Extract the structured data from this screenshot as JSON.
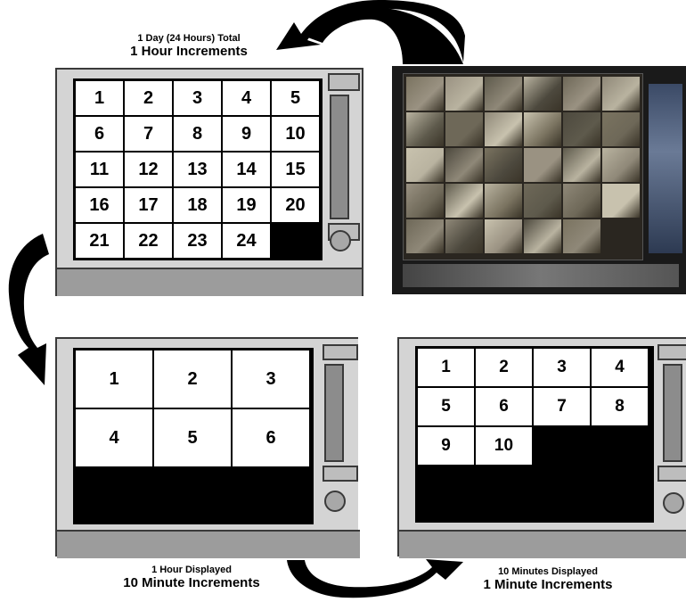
{
  "captions": {
    "top": {
      "line1": "1 Day (24 Hours) Total",
      "line2": "1 Hour Increments"
    },
    "bottom_left": {
      "line1": "1 Hour Displayed",
      "line2": "10 Minute Increments"
    },
    "bottom_right": {
      "line1": "10 Minutes Displayed",
      "line2": "1 Minute Increments"
    }
  },
  "panels": {
    "day_grid": [
      "1",
      "2",
      "3",
      "4",
      "5",
      "6",
      "7",
      "8",
      "9",
      "10",
      "11",
      "12",
      "13",
      "14",
      "15",
      "16",
      "17",
      "18",
      "19",
      "20",
      "21",
      "22",
      "23",
      "24"
    ],
    "hour_grid": [
      "1",
      "2",
      "3",
      "4",
      "5",
      "6"
    ],
    "minute_grid": [
      "1",
      "2",
      "3",
      "4",
      "5",
      "6",
      "7",
      "8",
      "9",
      "10"
    ]
  },
  "icons": [
    "arrow-top-curve-icon",
    "arrow-left-curve-icon",
    "arrow-bottom-curve-icon"
  ],
  "colors": {
    "panel": "#d4d4d4",
    "base": "#9c9c9c",
    "arrow": "#000000",
    "screen": "#000000"
  }
}
